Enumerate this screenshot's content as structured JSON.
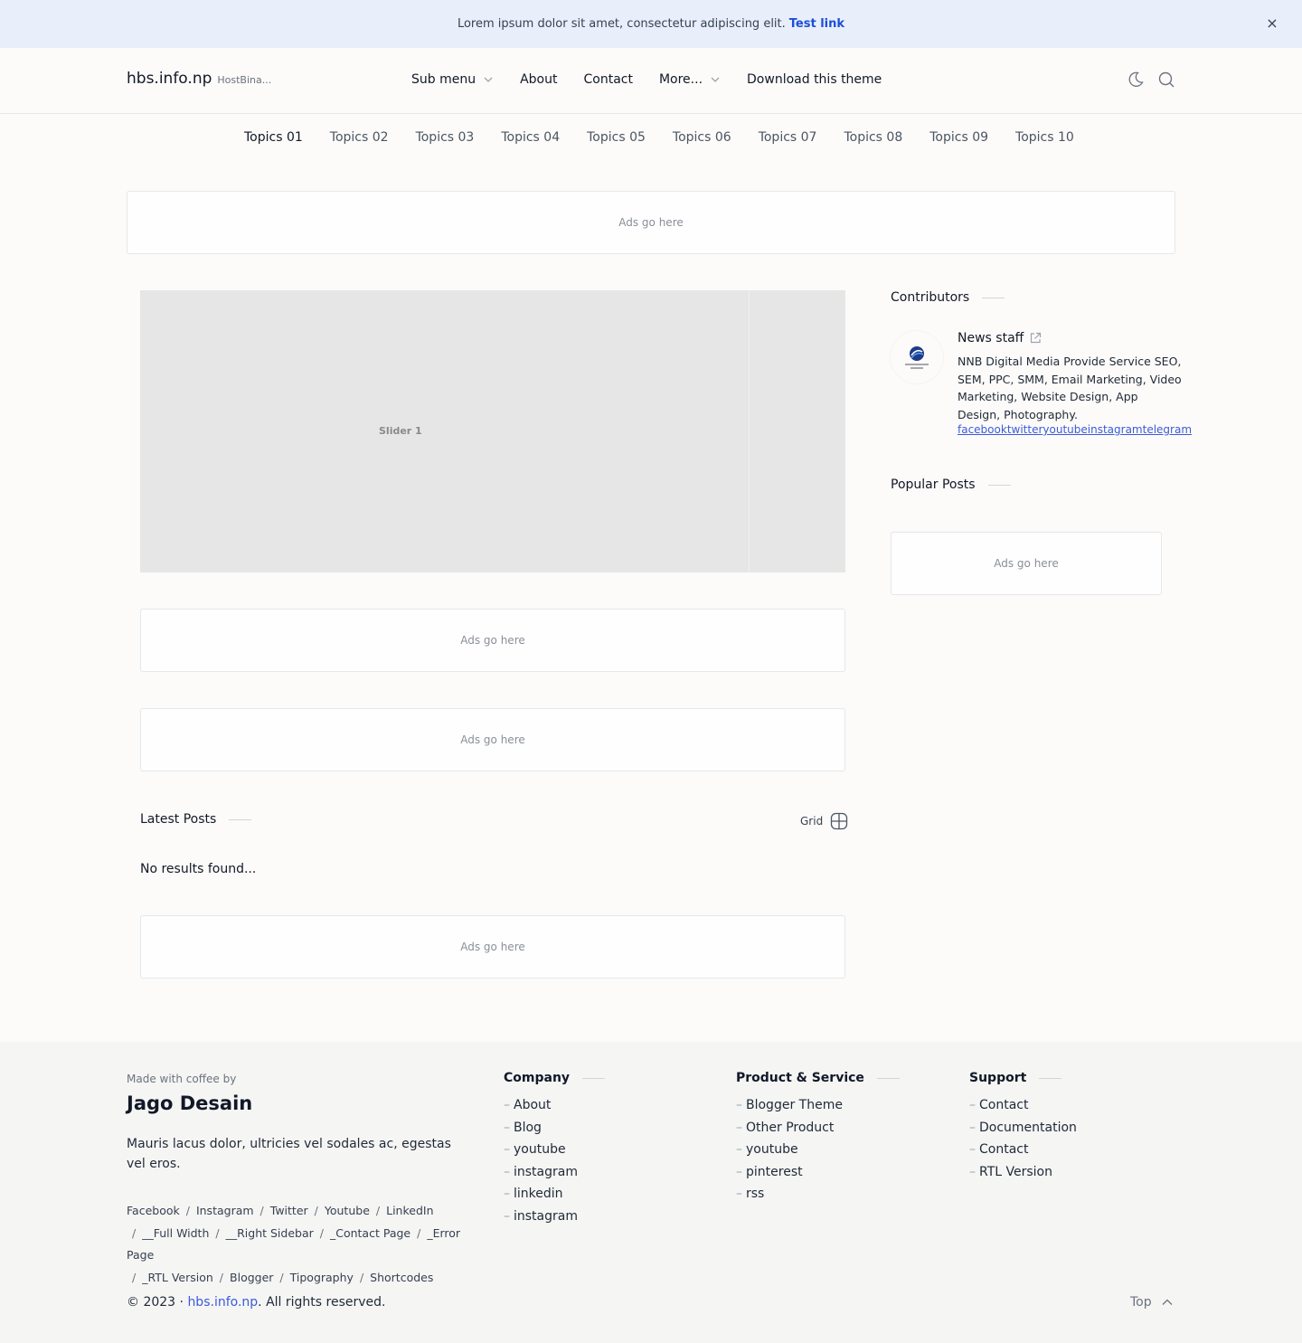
{
  "notice": {
    "text": "Lorem ipsum dolor sit amet, consectetur adipiscing elit.",
    "link": "Test link",
    "close": "×"
  },
  "header": {
    "brand": "hbs.info.np",
    "tagline": "HostBina...",
    "nav": [
      {
        "label": "Sub menu",
        "has_dropdown": true
      },
      {
        "label": "About",
        "has_dropdown": false
      },
      {
        "label": "Contact",
        "has_dropdown": false
      },
      {
        "label": "More...",
        "has_dropdown": true
      },
      {
        "label": "Download this theme",
        "has_dropdown": false
      }
    ],
    "icons": [
      "moon-icon",
      "search-icon"
    ]
  },
  "topics": [
    "Topics 01",
    "Topics 02",
    "Topics 03",
    "Topics 04",
    "Topics 05",
    "Topics 06",
    "Topics 07",
    "Topics 08",
    "Topics 09",
    "Topics 10"
  ],
  "ads": {
    "label": "Ads go here"
  },
  "slider": {
    "label": "Slider 1"
  },
  "contributors": {
    "heading": "Contributors",
    "name": "News staff",
    "avatar_text": "NNB DIGITAL MEDIA",
    "description": "NNB Digital Media Provide Service SEO, SEM, PPC, SMM, Email Marketing, Video Marketing, Website Design, App Design, Photography.",
    "social": [
      "facebook",
      "twitter",
      "youtube",
      "instagram",
      "telegram"
    ]
  },
  "popular": {
    "heading": "Popular Posts"
  },
  "latest": {
    "heading": "Latest Posts",
    "view_toggle": "Grid",
    "empty": "No results found..."
  },
  "footer": {
    "made_with": "Made with coffee by",
    "brand": "Jago Desain",
    "description": "Mauris lacus dolor, ultricies vel sodales ac, egestas vel eros.",
    "links": [
      "Facebook",
      "Instagram",
      "Twitter",
      "Youtube",
      "LinkedIn",
      "__Full Width",
      "__Right Sidebar",
      "_Contact Page",
      "_Error Page",
      "_RTL Version",
      "Blogger",
      "Tipography",
      "Shortcodes"
    ],
    "columns": [
      {
        "heading": "Company",
        "items": [
          "About",
          "Blog",
          "youtube",
          "instagram",
          "linkedin",
          "instagram"
        ]
      },
      {
        "heading": "Product & Service",
        "items": [
          "Blogger Theme",
          "Other Product",
          "youtube",
          "pinterest",
          "rss"
        ]
      },
      {
        "heading": "Support",
        "items": [
          "Contact",
          "Documentation",
          "Contact",
          "RTL Version"
        ]
      }
    ],
    "copyright_prefix": "© 2023 · ",
    "copyright_site": "hbs.info.np",
    "copyright_suffix": ". All rights reserved.",
    "top_label": "Top"
  },
  "colors": {
    "notice_bg": "#e8effb",
    "link_blue": "#1d4ed8",
    "page_bg": "#fcfbf9",
    "footer_bg": "#f5f5f4",
    "slider_bg": "#e6e6e6"
  }
}
